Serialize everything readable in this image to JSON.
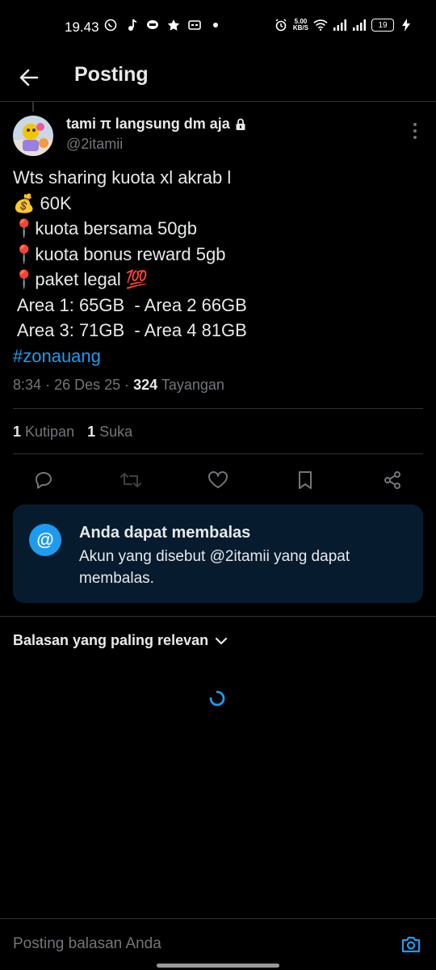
{
  "status_bar": {
    "time": "19.43",
    "network_speed_value": "5.00",
    "network_speed_unit": "KB/S",
    "battery": "19"
  },
  "header": {
    "title": "Posting"
  },
  "tweet": {
    "author_name": "tami π langsung dm aja",
    "author_handle": "@2itamii",
    "lines": [
      "Wts sharing kuota xl akrab l",
      "💰 60K",
      "📍kuota bersama 50gb",
      "📍kuota bonus reward 5gb",
      "📍paket legal 💯",
      " Area 1: 65GB  - Area 2 66GB",
      " Area 3: 71GB  - Area 4 81GB"
    ],
    "hashtag": "#zonauang",
    "time": "8:34",
    "date": "26 Des 25",
    "views_count": "324",
    "views_label": "Tayangan"
  },
  "stats": {
    "quotes_count": "1",
    "quotes_label": "Kutipan",
    "likes_count": "1",
    "likes_label": "Suka"
  },
  "notice": {
    "title": "Anda dapat membalas",
    "text": "Akun yang disebut @2itamii yang dapat membalas."
  },
  "replies": {
    "sort_label": "Balasan yang paling relevan"
  },
  "reply_bar": {
    "placeholder": "Posting balasan Anda"
  },
  "colors": {
    "accent": "#1d9bf0",
    "background": "#000000",
    "notice_bg": "#061b2e",
    "muted_text": "#71767b"
  }
}
